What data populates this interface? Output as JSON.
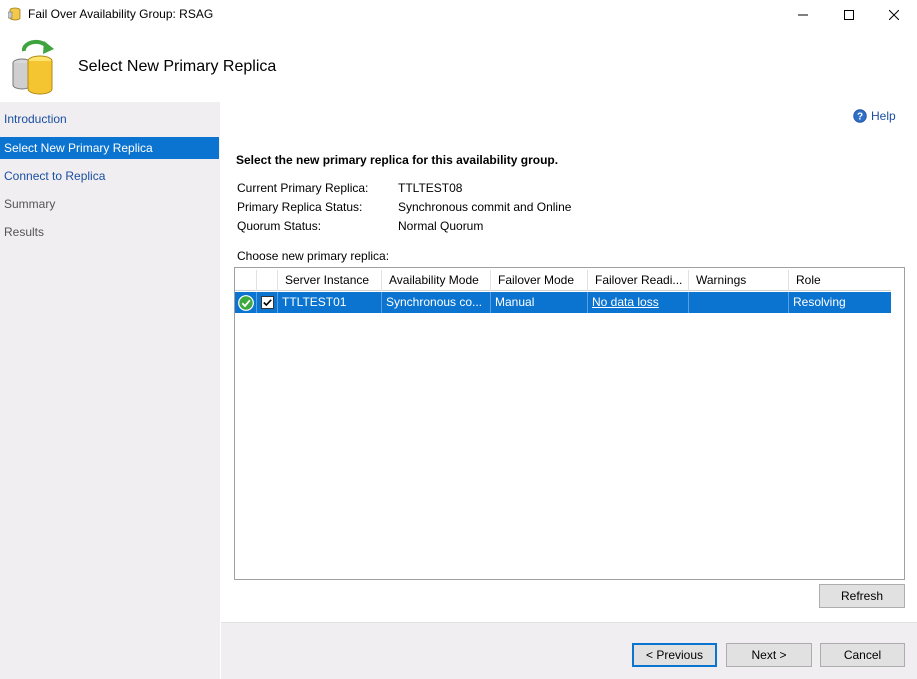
{
  "window": {
    "title": "Fail Over Availability Group: RSAG",
    "app_icon": "database-icon",
    "controls": {
      "minimize": "minimize-icon",
      "maximize": "maximize-icon",
      "close": "close-icon"
    }
  },
  "header": {
    "title": "Select New Primary Replica",
    "icon": "database-failover-icon"
  },
  "sidebar": {
    "items": [
      {
        "label": "Introduction",
        "state": "link"
      },
      {
        "label": "Select New Primary Replica",
        "state": "selected"
      },
      {
        "label": "Connect to Replica",
        "state": "link"
      },
      {
        "label": "Summary",
        "state": "muted"
      },
      {
        "label": "Results",
        "state": "muted"
      }
    ]
  },
  "content": {
    "help_label": "Help",
    "prompt": "Select the new primary replica for this availability group.",
    "info": [
      {
        "label": "Current Primary Replica:",
        "value": "TTLTEST08"
      },
      {
        "label": "Primary Replica Status:",
        "value": "Synchronous commit and Online"
      },
      {
        "label": "Quorum Status:",
        "value": "Normal Quorum"
      }
    ],
    "choose_label": "Choose new primary replica:",
    "grid": {
      "columns": [
        "",
        "",
        "Server Instance",
        "Availability Mode",
        "Failover Mode",
        "Failover Readi...",
        "Warnings",
        "Role"
      ],
      "rows": [
        {
          "status_icon": "green-check-icon",
          "checked": true,
          "server_instance": "TTLTEST01",
          "availability_mode": "Synchronous co...",
          "failover_mode": "Manual",
          "failover_readiness": "No data loss",
          "warnings": "",
          "role": "Resolving"
        }
      ]
    },
    "refresh_label": "Refresh"
  },
  "footer": {
    "previous_label": "< Previous",
    "next_label": "Next >",
    "cancel_label": "Cancel"
  },
  "colors": {
    "selection": "#0a74d0",
    "link": "#1a4fa0",
    "sidebar_bg": "#f0eef0"
  }
}
